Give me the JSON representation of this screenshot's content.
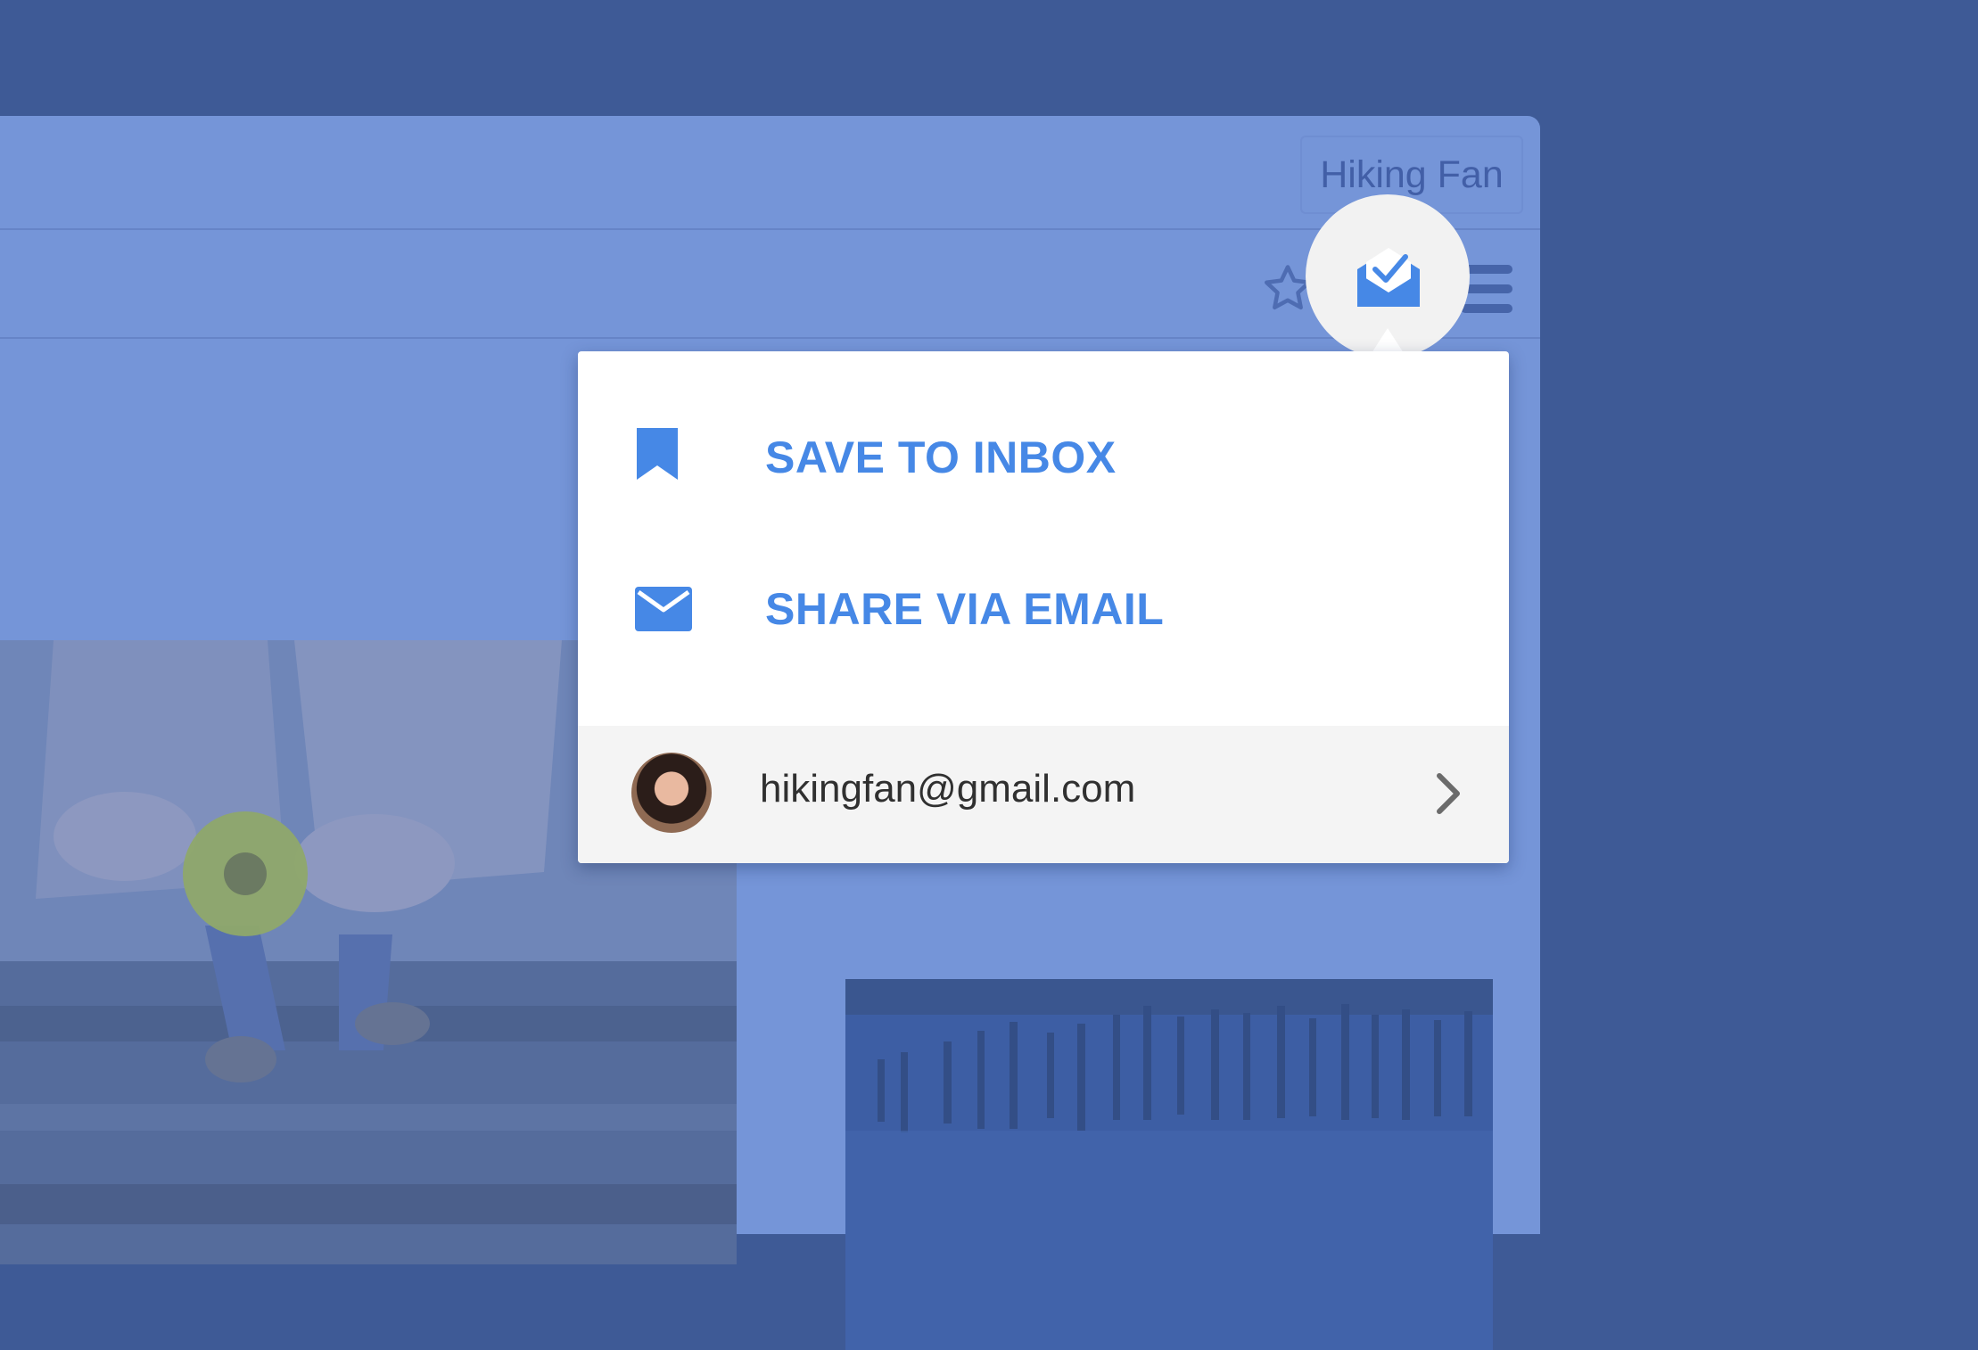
{
  "browser": {
    "profile_name": "Hiking Fan"
  },
  "toolbar": {
    "bookmark_icon": "star-icon",
    "extension_icon": "inbox-envelope-check-icon",
    "menu_icon": "hamburger-menu-icon"
  },
  "popup": {
    "actions": [
      {
        "label": "SAVE TO INBOX",
        "icon": "bookmark-icon"
      },
      {
        "label": "SHARE VIA EMAIL",
        "icon": "envelope-icon"
      }
    ],
    "account": {
      "email": "hikingfan@gmail.com",
      "icon": "chevron-right-icon"
    }
  },
  "colors": {
    "accent": "#4688e6",
    "overlay": "#7595d8",
    "background": "#3e5a96"
  }
}
